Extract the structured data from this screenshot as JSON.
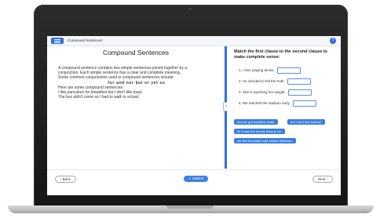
{
  "app": {
    "title": "Compound Sentences",
    "help_icon": "?"
  },
  "lesson": {
    "title": "Compound Sentences",
    "lines": [
      "A compound sentence contains two simple sentences joined together by a",
      "conjunction. Each simple sentence has a clear and complete meaning.",
      "Some common conjunctions used in compound sentences include:"
    ],
    "conjunctions": "for and nor but or yet so",
    "examples_intro": "Here are some compound sentences:",
    "examples": [
      "I like pancakes for breakfast but I don't like toast.",
      "The bus didn't come so I had to walk to school."
    ]
  },
  "exercise": {
    "heading": "Match the first clause to the second clause to make complete sense:",
    "clauses": [
      "1. I love playing tennis,",
      "2. He decided to tell the truth,",
      "3. She is watching her weight,",
      "4. We reached the stadium early,"
    ],
    "answer_chips": [
      "and we got excellent seats.",
      "but I don't like football.",
      "for it was the honest thing to do.",
      "yet the chocolate cake looked delicious."
    ]
  },
  "nav": {
    "back_label": "‹ Back",
    "submit_label": "✓ Submit",
    "next_label": "Next ›"
  },
  "colors": {
    "accent": "#3d7fe0",
    "frame": "#1e1e1e"
  }
}
